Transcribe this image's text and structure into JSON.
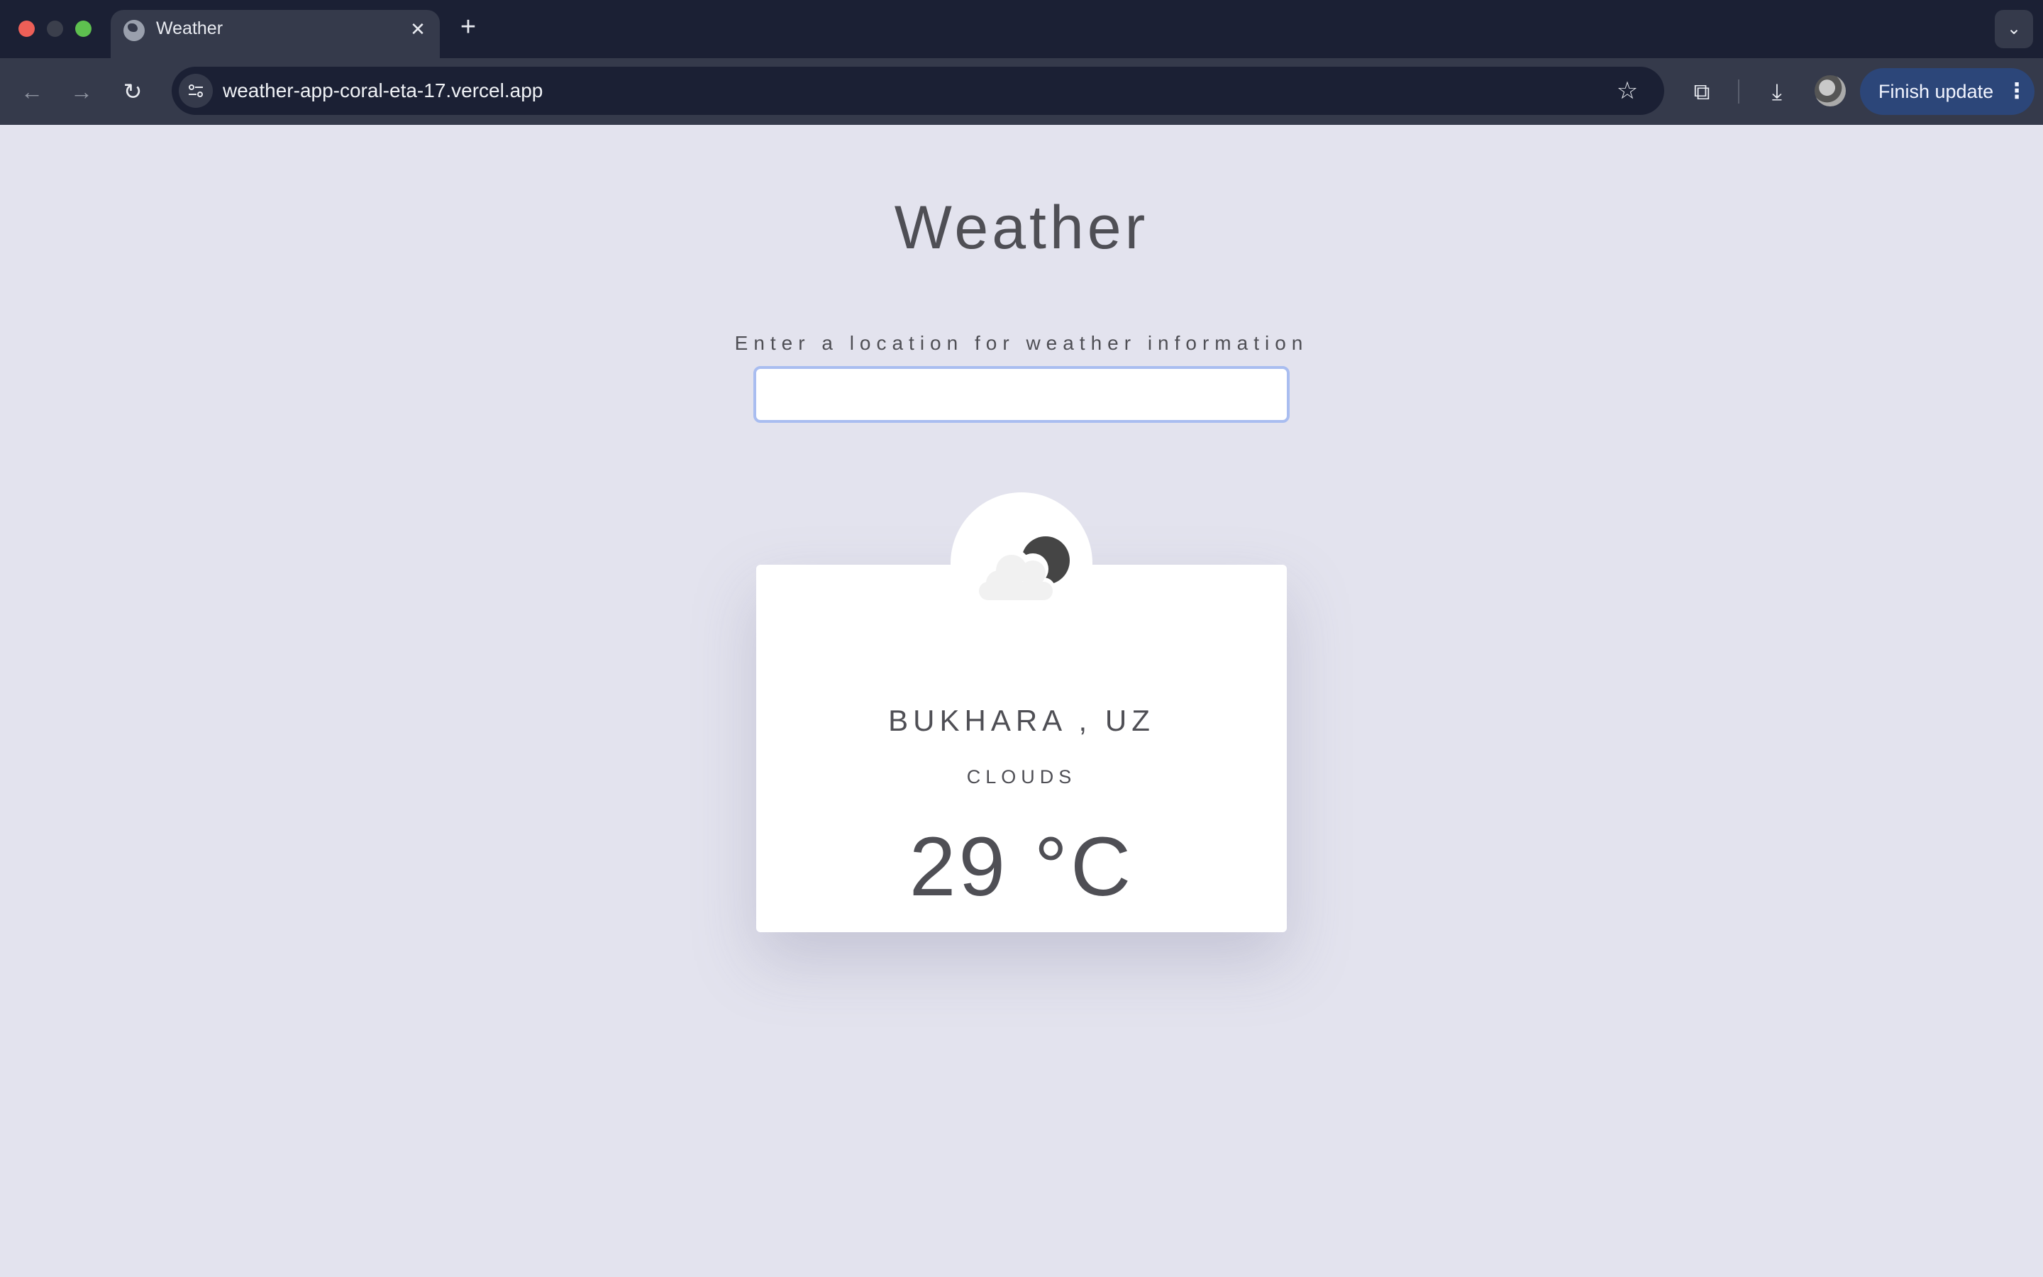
{
  "browser": {
    "tab_title": "Weather",
    "tab_close": "✕",
    "new_tab": "+",
    "tab_search": "⌄",
    "url": "weather-app-coral-eta-17.vercel.app",
    "back": "←",
    "forward": "→",
    "reload": "↻",
    "bookmark": "☆",
    "extensions": "⧉",
    "download": "⤓",
    "finish_update_label": "Finish update",
    "menu": "⋮"
  },
  "page": {
    "title": "Weather",
    "search_label": "Enter a location for weather information",
    "search_value": ""
  },
  "weather": {
    "icon": "cloud-moon-icon",
    "city": "BUKHARA , UZ",
    "condition": "CLOUDS",
    "temperature": "29 °C"
  },
  "colors": {
    "page_bg": "#e3e3ee",
    "text": "#4f4f55",
    "input_focus_border": "#a9bdf0",
    "finish_update_bg": "#2c4679"
  }
}
